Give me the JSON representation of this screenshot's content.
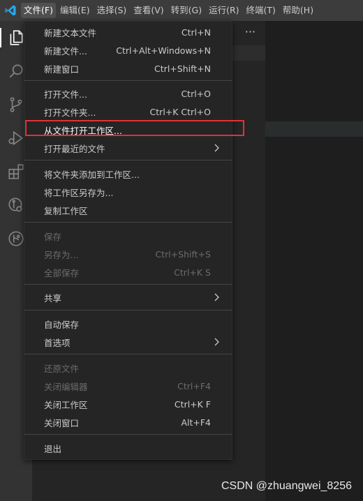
{
  "menubar": {
    "items": [
      "文件(F)",
      "编辑(E)",
      "选择(S)",
      "查看(V)",
      "转到(G)",
      "运行(R)",
      "终端(T)",
      "帮助(H)"
    ]
  },
  "activitybar": {
    "icons": [
      "explorer-icon",
      "search-icon",
      "source-control-icon",
      "run-debug-icon",
      "extensions-icon",
      "remote-explorer-icon",
      "git-graph-icon"
    ]
  },
  "sidebar": {
    "more": "···"
  },
  "file_menu": {
    "items": [
      {
        "label": "新建文本文件",
        "shortcut": "Ctrl+N"
      },
      {
        "label": "新建文件...",
        "shortcut": "Ctrl+Alt+Windows+N"
      },
      {
        "label": "新建窗口",
        "shortcut": "Ctrl+Shift+N"
      },
      {
        "label": "打开文件...",
        "shortcut": "Ctrl+O"
      },
      {
        "label": "打开文件夹...",
        "shortcut": "Ctrl+K Ctrl+O"
      },
      {
        "label": "从文件打开工作区...",
        "shortcut": ""
      },
      {
        "label": "打开最近的文件",
        "shortcut": ""
      },
      {
        "label": "将文件夹添加到工作区...",
        "shortcut": ""
      },
      {
        "label": "将工作区另存为...",
        "shortcut": ""
      },
      {
        "label": "复制工作区",
        "shortcut": ""
      },
      {
        "label": "保存",
        "shortcut": ""
      },
      {
        "label": "另存为...",
        "shortcut": "Ctrl+Shift+S"
      },
      {
        "label": "全部保存",
        "shortcut": "Ctrl+K S"
      },
      {
        "label": "共享",
        "shortcut": ""
      },
      {
        "label": "自动保存",
        "shortcut": ""
      },
      {
        "label": "首选项",
        "shortcut": ""
      },
      {
        "label": "还原文件",
        "shortcut": ""
      },
      {
        "label": "关闭编辑器",
        "shortcut": "Ctrl+F4"
      },
      {
        "label": "关闭工作区",
        "shortcut": "Ctrl+K F"
      },
      {
        "label": "关闭窗口",
        "shortcut": "Alt+F4"
      },
      {
        "label": "退出",
        "shortcut": ""
      }
    ]
  },
  "watermark": "CSDN @zhuangwei_8256",
  "colors": {
    "accent": "#0078d4",
    "highlight_box": "#e23232",
    "menu_bg": "#252526",
    "disabled_text": "#6b6b6b"
  }
}
